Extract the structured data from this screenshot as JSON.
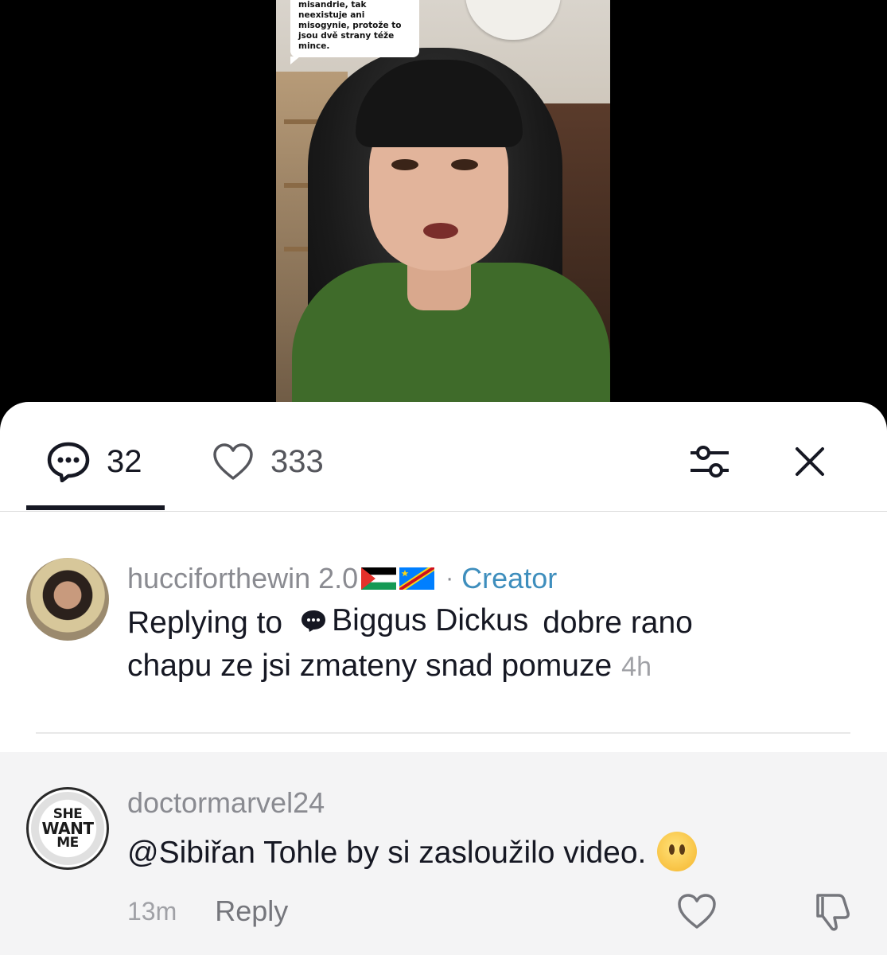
{
  "video": {
    "caption_lines": [
      "misandrie, tak",
      "neexistuje ani",
      "misogynie, protože to",
      "jsou dvě strany téže",
      "mince."
    ]
  },
  "tabs": {
    "comments_count": "32",
    "likes_count": "333"
  },
  "comments": [
    {
      "author": "hucciforthewin 2.0",
      "flags": [
        "palestine-flag",
        "congo-flag"
      ],
      "separator": "·",
      "badge": "Creator",
      "reply_prefix": "Replying to",
      "reply_target": "Biggus Dickus",
      "text_line1": "dobre rano",
      "text_line2": "chapu ze jsi zmateny snad pomuze",
      "time": "4h"
    },
    {
      "author": "doctormarvel24",
      "avatar_text": [
        "SHE",
        "WANT",
        "ME"
      ],
      "text": "@Sibiřan Tohle by si zasloužilo video.",
      "emoji": "neutral-face-emoji",
      "time": "13m",
      "reply_label": "Reply"
    }
  ],
  "colors": {
    "creator": "#3e8ebd",
    "text": "#161823",
    "muted": "#8a8b91"
  }
}
